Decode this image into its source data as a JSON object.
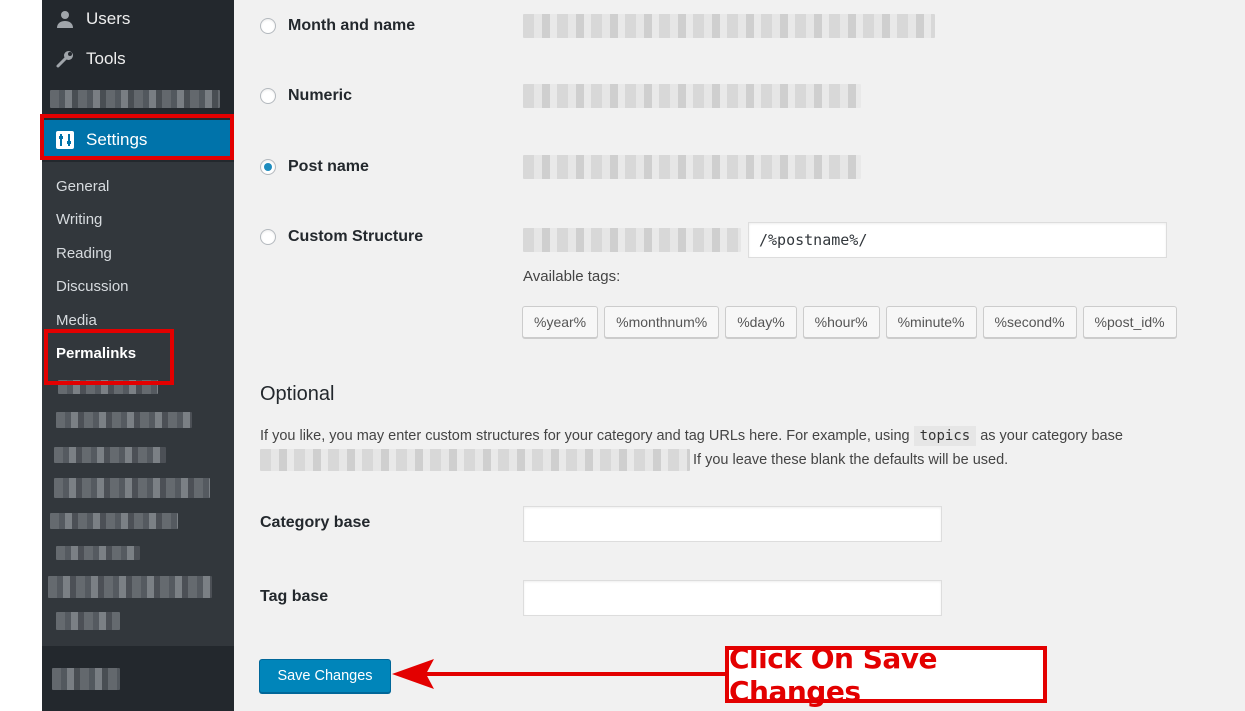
{
  "sidebar": {
    "menu": {
      "users": "Users",
      "tools": "Tools",
      "settings": "Settings"
    },
    "submenu": [
      "General",
      "Writing",
      "Reading",
      "Discussion",
      "Media",
      "Permalinks"
    ],
    "current_submenu": "Permalinks"
  },
  "permalinks": {
    "options": [
      {
        "label": "Month and name",
        "checked": false
      },
      {
        "label": "Numeric",
        "checked": false
      },
      {
        "label": "Post name",
        "checked": true
      },
      {
        "label": "Custom Structure",
        "checked": false
      }
    ],
    "custom_structure_value": "/%postname%/",
    "available_tags_label": "Available tags:",
    "tags": [
      "%year%",
      "%monthnum%",
      "%day%",
      "%hour%",
      "%minute%",
      "%second%",
      "%post_id%"
    ]
  },
  "optional": {
    "title": "Optional",
    "desc_before": "If you like, you may enter custom structures for your category and tag URLs here. For example, using",
    "desc_code": "topics",
    "desc_after": "as your category base",
    "desc_line2": "If you leave these blank the defaults will be used.",
    "category_base_label": "Category base",
    "category_base_value": "",
    "tag_base_label": "Tag base",
    "tag_base_value": ""
  },
  "save_button": "Save Changes",
  "annotation": {
    "callout_text": "Click On Save Changes",
    "color": "#e30000"
  },
  "colors": {
    "sidebar_bg": "#23282d",
    "active_menu": "#0073aa",
    "button_primary": "#0085ba"
  }
}
